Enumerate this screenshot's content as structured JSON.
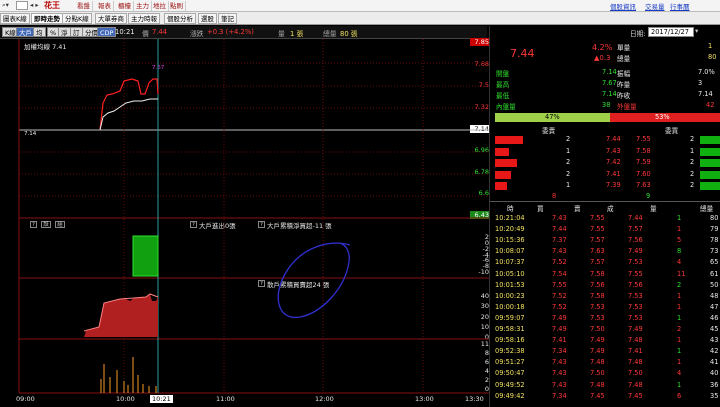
{
  "topbar": {
    "app_name": "花王",
    "menu": [
      "看盤",
      "報表",
      "櫃檯",
      "主力",
      "地拉",
      "點刷"
    ],
    "right_links": [
      "個股資訊",
      "交易量",
      "行事曆"
    ]
  },
  "tabs": [
    "圖表K線",
    "即時走勢",
    "分點K線",
    "大單券商",
    "主力時報",
    "個股分析",
    "選股",
    "筆記"
  ],
  "toolbar": {
    "buttons": [
      "K線",
      "大戶",
      "均",
      "%",
      "淨",
      "訂",
      "分價",
      "CDP"
    ],
    "time": "10:21",
    "price_label": "價",
    "price": "7.44",
    "change_label": "漲跌",
    "change": "+0.3 (+4.2%)",
    "vol_label": "量",
    "vol": "1 張",
    "total_label": "總量",
    "total": "80 張"
  },
  "chart": {
    "ma_label": "加權均線 7.41",
    "high_annot": "7.67",
    "low_annot": "7.14",
    "y_top": [
      "7.85",
      "7.68",
      "7.5",
      "7.32",
      "7.14",
      "6.96",
      "6.78",
      "6.6",
      "6.43"
    ],
    "indicator_btns": [
      "?",
      "設",
      "組"
    ],
    "y_mid": [
      "2",
      "0",
      "-2",
      "-4",
      "-6",
      "-8",
      "-10"
    ],
    "y_low": [
      "40",
      "30",
      "20",
      "10",
      "0"
    ],
    "y_bot": [
      "11",
      "8",
      "6",
      "4",
      "2",
      "0"
    ],
    "x_ticks": [
      "09:00",
      "10:00",
      "10:21",
      "11:00",
      "12:00",
      "13:00",
      "13:30"
    ],
    "annot1": "大戶進出0張",
    "annot2": "大戶累積淨買超-11 張",
    "annot3": "散戶累積買賣超24 張",
    "colors": {
      "up": "#ff2020",
      "down": "#20c020",
      "vol": "#d08020"
    }
  },
  "right": {
    "date_label": "日期:",
    "date": "2017/12/27",
    "big_price": "7.44",
    "pct": "4.2%",
    "delta": "▲0.3",
    "lbl_unit": "單量",
    "lbl_total": "總量",
    "unit": "1",
    "total": "80",
    "stats": [
      [
        "開盤",
        "7.14",
        "振幅",
        "7.0%"
      ],
      [
        "最高",
        "7.67",
        "昨量",
        "3"
      ],
      [
        "最低",
        "7.14",
        "昨收",
        "7.14"
      ]
    ],
    "inner": [
      "內盤量",
      "38",
      "外盤量",
      "42"
    ],
    "bar": [
      "47%",
      "53%"
    ],
    "bid_h": "委賣",
    "ask_h": "委買",
    "book": [
      [
        "2",
        "7.44",
        "7.55",
        "2"
      ],
      [
        "1",
        "7.43",
        "7.58",
        "1"
      ],
      [
        "2",
        "7.42",
        "7.59",
        "2"
      ],
      [
        "2",
        "7.41",
        "7.60",
        "2"
      ],
      [
        "1",
        "7.39",
        "7.63",
        "2"
      ]
    ],
    "sum": [
      "8",
      "9"
    ],
    "th": [
      "時",
      "買",
      "賣",
      "成",
      "量",
      "總量"
    ],
    "ticks": [
      [
        "10:21:04",
        "7.43",
        "7.55",
        "7.44",
        "1",
        "80"
      ],
      [
        "10:20:49",
        "7.44",
        "7.55",
        "7.57",
        "1",
        "79"
      ],
      [
        "10:15:36",
        "7.37",
        "7.57",
        "7.56",
        "5",
        "78"
      ],
      [
        "10:08:07",
        "7.43",
        "7.63",
        "7.49",
        "8",
        "73"
      ],
      [
        "10:07:37",
        "7.52",
        "7.57",
        "7.53",
        "4",
        "65"
      ],
      [
        "10:05:10",
        "7.54",
        "7.58",
        "7.55",
        "11",
        "61"
      ],
      [
        "10:01:53",
        "7.55",
        "7.56",
        "7.56",
        "2",
        "50"
      ],
      [
        "10:00:23",
        "7.52",
        "7.58",
        "7.53",
        "1",
        "48"
      ],
      [
        "10:00:18",
        "7.52",
        "7.53",
        "7.53",
        "1",
        "47"
      ],
      [
        "09:59:07",
        "7.49",
        "7.53",
        "7.53",
        "1",
        "46"
      ],
      [
        "09:58:31",
        "7.49",
        "7.50",
        "7.49",
        "2",
        "45"
      ],
      [
        "09:58:16",
        "7.41",
        "7.49",
        "7.48",
        "1",
        "43"
      ],
      [
        "09:52:38",
        "7.34",
        "7.49",
        "7.41",
        "1",
        "42"
      ],
      [
        "09:51:27",
        "7.43",
        "7.48",
        "7.48",
        "1",
        "41"
      ],
      [
        "09:50:47",
        "7.43",
        "7.50",
        "7.50",
        "4",
        "40"
      ],
      [
        "09:49:52",
        "7.43",
        "7.48",
        "7.48",
        "1",
        "36"
      ],
      [
        "09:49:42",
        "7.34",
        "7.45",
        "7.45",
        "6",
        "35"
      ]
    ]
  }
}
